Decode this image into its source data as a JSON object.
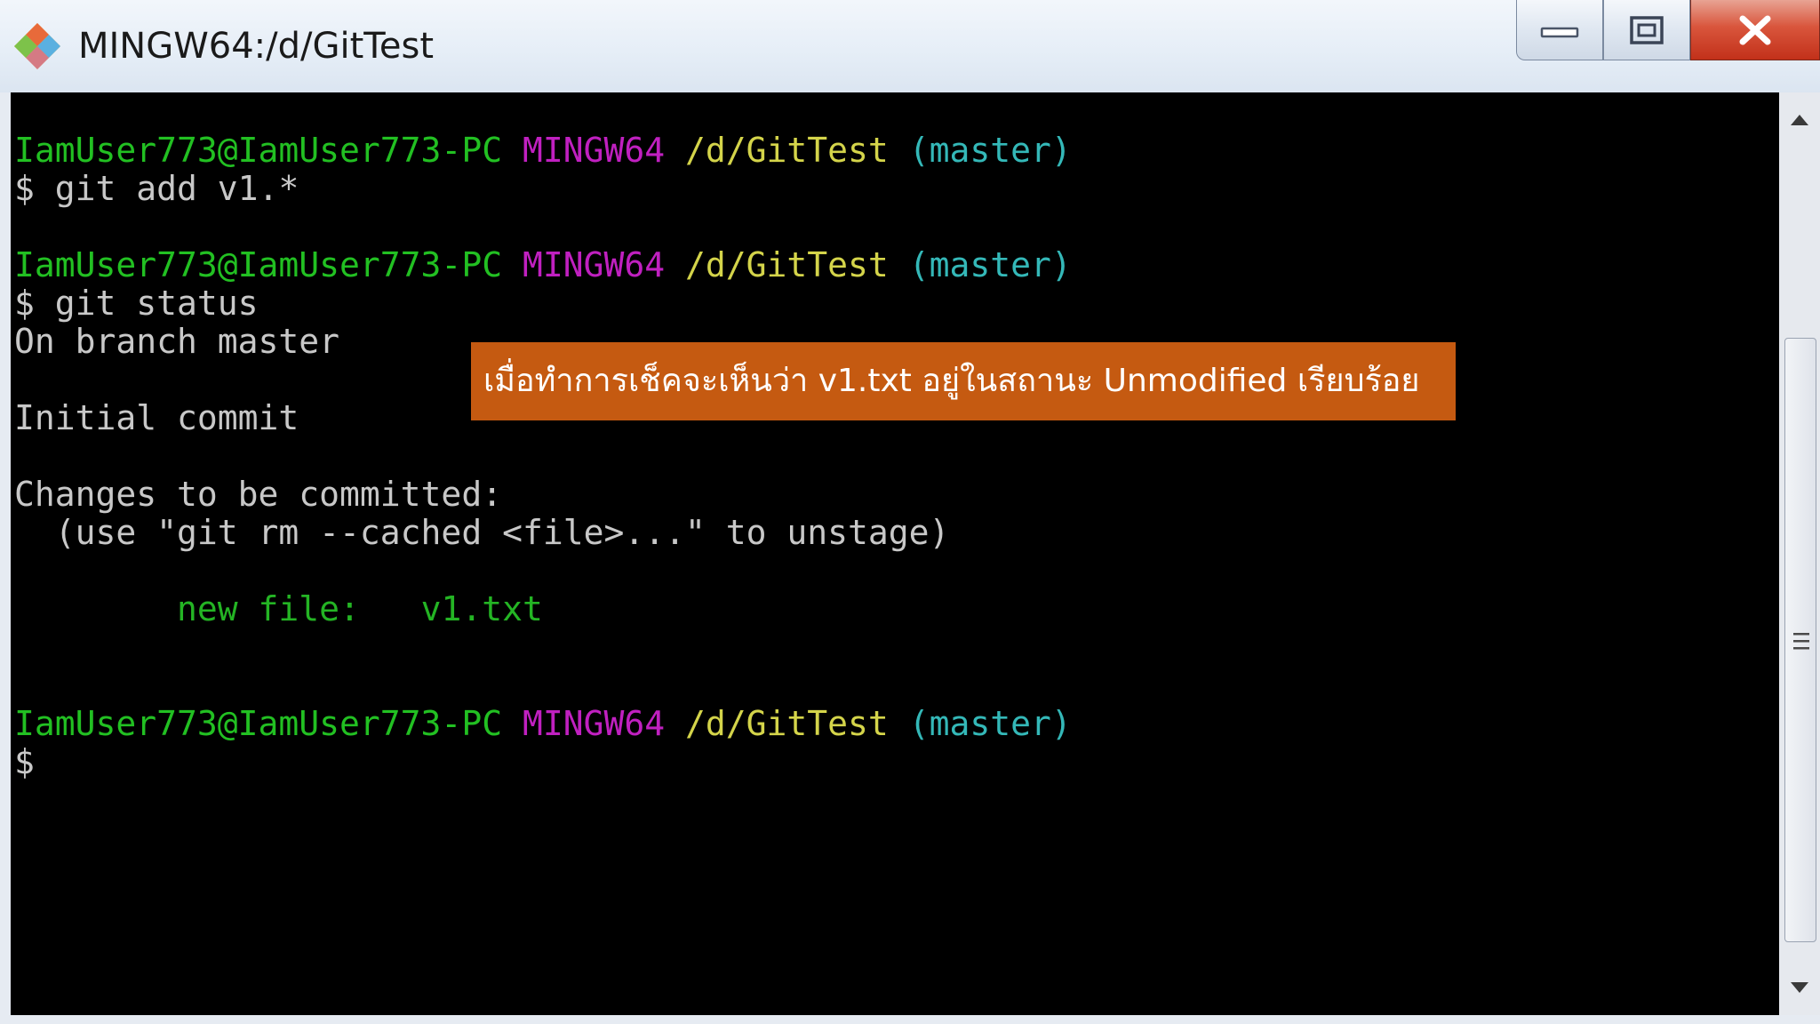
{
  "window": {
    "title": "MINGW64:/d/GitTest",
    "app_icon": "git-icon",
    "buttons": {
      "minimize_icon": "minimize-icon",
      "maximize_icon": "maximize-icon",
      "close_icon": "close-icon"
    }
  },
  "prompt": {
    "user": "IamUser773@IamUser773-PC",
    "shell": "MINGW64",
    "path": "/d/GitTest",
    "branch": "(master)",
    "symbol": "$"
  },
  "terminal": {
    "cmd1": "git add v1.*",
    "cmd2": "git status",
    "out_branch": "On branch master",
    "out_initial": "Initial commit",
    "out_changes": "Changes to be committed:",
    "out_hint": "  (use \"git rm --cached <file>...\" to unstage)",
    "new_file_label": "        new file:",
    "new_file_name": "v1.txt"
  },
  "annotation": {
    "text": "เมื่อทำการเช็คจะเห็นว่า v1.txt อยู่ในสถานะ Unmodified เรียบร้อย"
  },
  "colors": {
    "prompt_user": "#22c022",
    "prompt_shell": "#c020c0",
    "prompt_path": "#d4d44a",
    "prompt_branch": "#34b8b8",
    "staged_file": "#24b424",
    "annotation_bg": "#c55a11",
    "terminal_bg": "#000000"
  }
}
